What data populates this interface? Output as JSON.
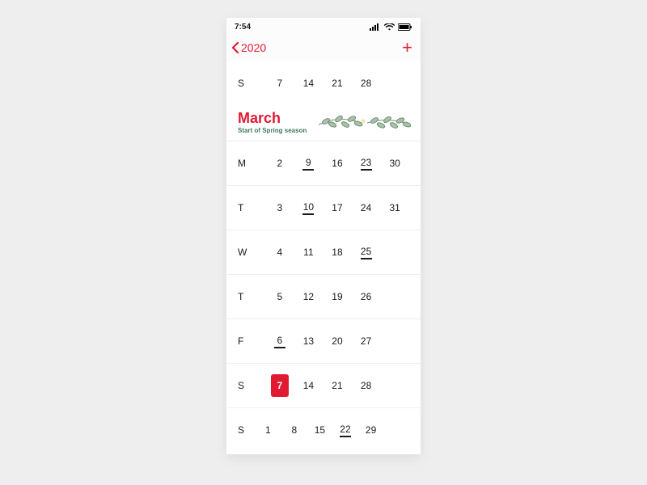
{
  "statusbar": {
    "time": "7:54"
  },
  "nav": {
    "back_label": "2020",
    "add_glyph": "+"
  },
  "banner": {
    "month": "March",
    "subtitle": "Start of Spring season"
  },
  "accent_color": "#e11931",
  "selected_date": "7",
  "rows": [
    {
      "label": "S",
      "cells": [
        "7",
        "14",
        "21",
        "28",
        ""
      ]
    },
    {
      "label": "M",
      "cells": [
        "2",
        "9",
        "16",
        "23",
        "30"
      ],
      "marked": [
        "9",
        "23"
      ]
    },
    {
      "label": "T",
      "cells": [
        "3",
        "10",
        "17",
        "24",
        "31"
      ],
      "marked": [
        "10"
      ]
    },
    {
      "label": "W",
      "cells": [
        "4",
        "11",
        "18",
        "25",
        ""
      ],
      "marked": [
        "25"
      ]
    },
    {
      "label": "T",
      "cells": [
        "5",
        "12",
        "19",
        "26",
        ""
      ]
    },
    {
      "label": "F",
      "cells": [
        "6",
        "13",
        "20",
        "27",
        ""
      ],
      "marked": [
        "6"
      ]
    },
    {
      "label": "S",
      "cells": [
        "7",
        "14",
        "21",
        "28",
        ""
      ],
      "selected": "7"
    },
    {
      "label": "S",
      "cells": [
        "1",
        "8",
        "15",
        "22",
        "29",
        ""
      ],
      "marked": [
        "22"
      ]
    }
  ]
}
